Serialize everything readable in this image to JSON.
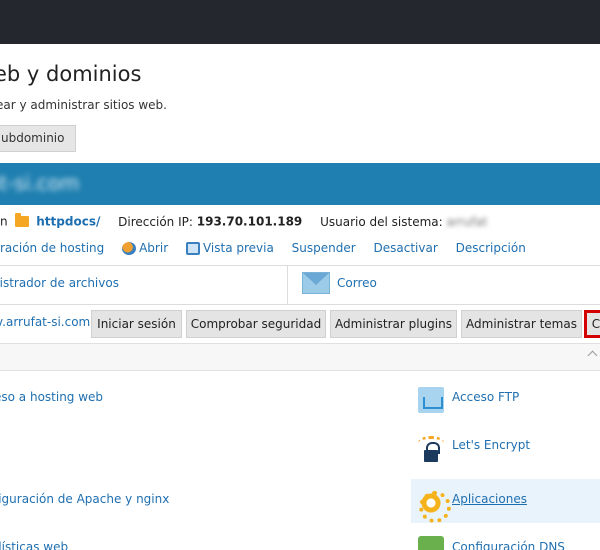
{
  "header": {
    "title": "eb y dominios",
    "subtitle": "ear y administrar sitios web.",
    "subdomain_button": "ubdominio"
  },
  "domain": {
    "name": "fat-si.com"
  },
  "info": {
    "prefix": "n",
    "docroot": "httpdocs/",
    "ip_label": "Dirección IP:",
    "ip_value": "193.70.101.189",
    "user_label": "Usuario del sistema:",
    "user_value": "arrufat"
  },
  "actions": {
    "hosting": "ración de hosting",
    "open": "Abrir",
    "preview": "Vista previa",
    "suspend": "Suspender",
    "deactivate": "Desactivar",
    "description": "Descripción"
  },
  "quick": {
    "file_manager": "nistrador de archivos",
    "mail": "Correo"
  },
  "wordpress": {
    "url": "v.arrufat-si.com",
    "buttons": [
      "Iniciar sesión",
      "Comprobar seguridad",
      "Administrar plugins",
      "Administrar temas",
      "C"
    ]
  },
  "tools_left": {
    "hosting_access": "eso a hosting web",
    "apache": "figuración de Apache y nginx",
    "stats": "dísticas web"
  },
  "tools_right": {
    "ftp": "Acceso FTP",
    "letsencrypt": "Let's Encrypt",
    "apps": "Aplicaciones",
    "dns": "Configuración DNS"
  },
  "colors": {
    "topbar": "#24272d",
    "domain_bar": "#1f7fb0",
    "link": "#1f6fb0",
    "highlight_border": "#d40000"
  }
}
